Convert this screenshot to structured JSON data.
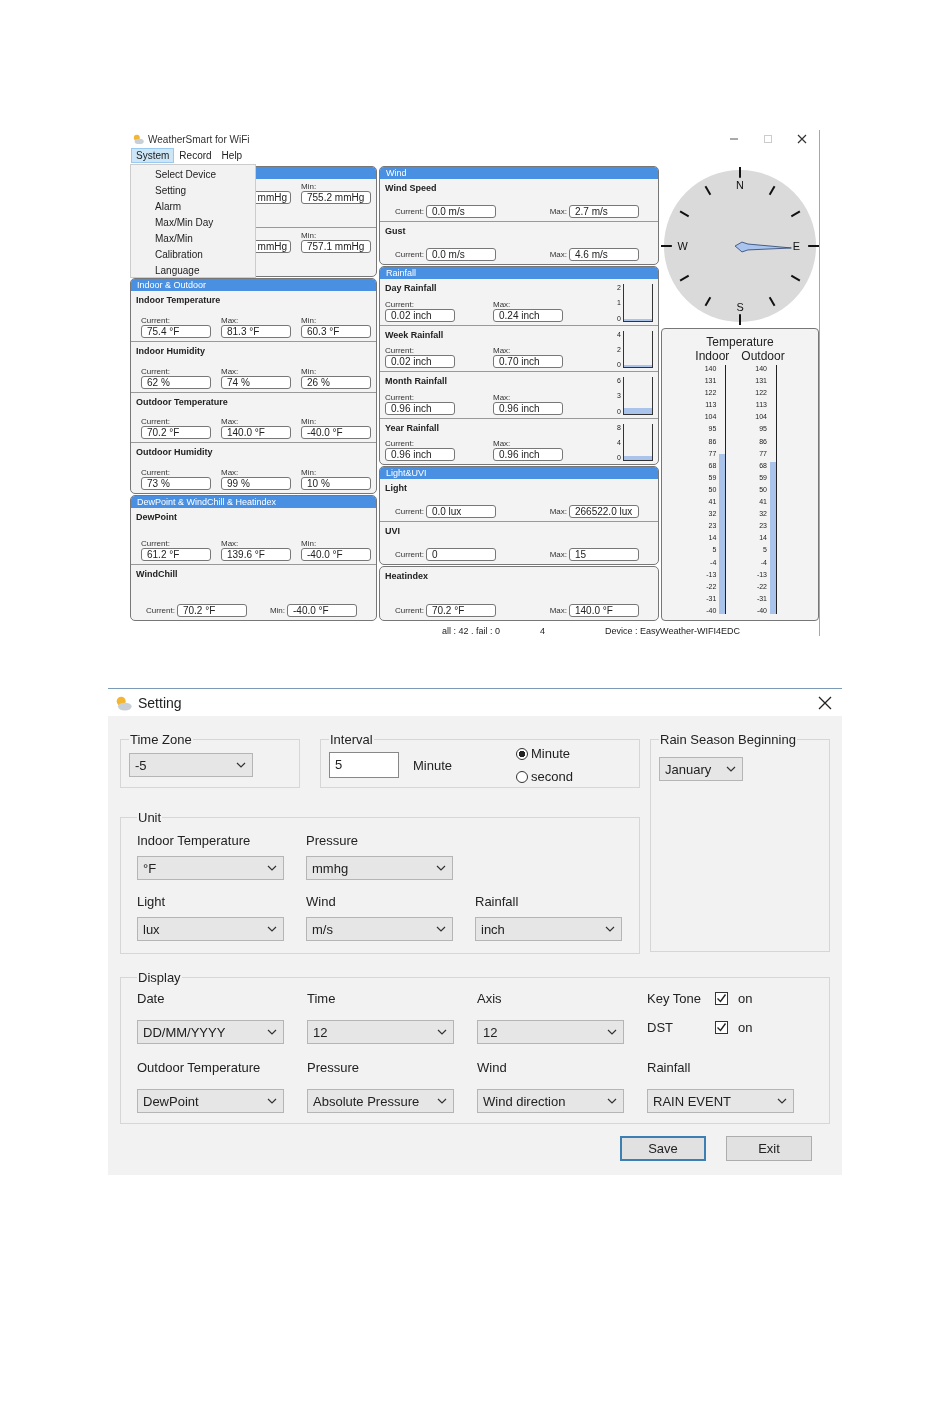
{
  "main_window": {
    "title": "WeatherSmart for WiFi",
    "menu": [
      {
        "label": "System",
        "selected": true
      },
      {
        "label": "Record",
        "selected": false
      },
      {
        "label": "Help",
        "selected": false
      }
    ],
    "open_menu": {
      "items": [
        "Select Device",
        "Setting",
        "Alarm",
        "Max/Min Day",
        "Max/Min",
        "Calibration",
        "Language"
      ]
    },
    "columns": [
      {
        "panels": [
          {
            "kind": "headed",
            "sections": [
              {
                "kind": "stacked",
                "fields": [
                  {
                    "value": "mmHg"
                  },
                  {
                    "label": "Min:",
                    "value": "755.2 mmHg"
                  }
                ]
              },
              {
                "kind": "stacked",
                "fields": [
                  {
                    "value": "mmHg"
                  },
                  {
                    "label": "Min:",
                    "value": "757.1 mmHg"
                  }
                ]
              }
            ]
          },
          {
            "kind": "headed",
            "header": "Indoor & Outdoor",
            "sections": [
              {
                "kind": "stacked",
                "title": "Indoor Temperature",
                "fields": [
                  {
                    "label": "Current:",
                    "value": "75.4 °F"
                  },
                  {
                    "label": "Max:",
                    "value": "81.3 °F"
                  },
                  {
                    "label": "Min:",
                    "value": "60.3 °F"
                  }
                ]
              },
              {
                "kind": "stacked",
                "title": "Indoor Humidity",
                "fields": [
                  {
                    "label": "Current:",
                    "value": "62 %"
                  },
                  {
                    "label": "Max:",
                    "value": "74 %"
                  },
                  {
                    "label": "Min:",
                    "value": "26 %"
                  }
                ]
              },
              {
                "kind": "stacked",
                "title": "Outdoor Temperature",
                "fields": [
                  {
                    "label": "Current:",
                    "value": "70.2 °F"
                  },
                  {
                    "label": "Max:",
                    "value": "140.0 °F"
                  },
                  {
                    "label": "Min:",
                    "value": "-40.0 °F"
                  }
                ]
              },
              {
                "kind": "stacked",
                "title": "Outdoor Humidity",
                "fields": [
                  {
                    "label": "Current:",
                    "value": "73 %"
                  },
                  {
                    "label": "Max:",
                    "value": "99 %"
                  },
                  {
                    "label": "Min:",
                    "value": "10 %"
                  }
                ]
              }
            ]
          },
          {
            "kind": "headed",
            "header": "DewPoint & WindChill & Heatindex",
            "sections": [
              {
                "kind": "stacked",
                "title": "DewPoint",
                "fields": [
                  {
                    "label": "Current:",
                    "value": "61.2 °F"
                  },
                  {
                    "label": "Max:",
                    "value": "139.6 °F"
                  },
                  {
                    "label": "Min:",
                    "value": "-40.0 °F"
                  }
                ]
              },
              {
                "kind": "inline",
                "title": "WindChill",
                "fields": [
                  {
                    "label": "Current:",
                    "value": "70.2 °F"
                  },
                  {
                    "label": "Min:",
                    "value": "-40.0 °F"
                  }
                ]
              }
            ]
          }
        ]
      },
      {
        "panels": [
          {
            "kind": "headed",
            "header": "Wind",
            "sections": [
              {
                "kind": "inline",
                "title": "Wind Speed",
                "fields": [
                  {
                    "label": "Current:",
                    "value": "0.0 m/s"
                  },
                  {
                    "label": "Max:",
                    "value": "2.7 m/s"
                  }
                ]
              },
              {
                "kind": "inline",
                "title": "Gust",
                "fields": [
                  {
                    "label": "Current:",
                    "value": "0.0 m/s"
                  },
                  {
                    "label": "Max:",
                    "value": "4.6 m/s"
                  }
                ]
              }
            ]
          },
          {
            "kind": "headed",
            "header": "Rainfall",
            "sections": [
              {
                "kind": "stacked",
                "title": "Day Rainfall",
                "fields": [
                  {
                    "label": "Current:",
                    "value": "0.02 inch"
                  },
                  {
                    "label": "Max:",
                    "value": "0.24 inch"
                  }
                ],
                "gauge": {
                  "ticks": [
                    "2",
                    "1",
                    "0"
                  ],
                  "level": 0.01
                }
              },
              {
                "kind": "stacked",
                "title": "Week Rainfall",
                "fields": [
                  {
                    "label": "Current:",
                    "value": "0.02 inch"
                  },
                  {
                    "label": "Max:",
                    "value": "0.70 inch"
                  }
                ],
                "gauge": {
                  "ticks": [
                    "4",
                    "2",
                    "0"
                  ],
                  "level": 0.005
                }
              },
              {
                "kind": "stacked",
                "title": "Month Rainfall",
                "fields": [
                  {
                    "label": "Current:",
                    "value": "0.96 inch"
                  },
                  {
                    "label": "Max:",
                    "value": "0.96 inch"
                  }
                ],
                "gauge": {
                  "ticks": [
                    "6",
                    "3",
                    "0"
                  ],
                  "level": 0.16
                }
              },
              {
                "kind": "stacked",
                "title": "Year Rainfall",
                "fields": [
                  {
                    "label": "Current:",
                    "value": "0.96 inch"
                  },
                  {
                    "label": "Max:",
                    "value": "0.96 inch"
                  }
                ],
                "gauge": {
                  "ticks": [
                    "8",
                    "4",
                    "0"
                  ],
                  "level": 0.12
                }
              }
            ]
          },
          {
            "kind": "headed",
            "header": "Light&UVI",
            "sections": [
              {
                "kind": "inline",
                "title": "Light",
                "fields": [
                  {
                    "label": "Current:",
                    "value": "0.0 lux"
                  },
                  {
                    "label": "Max:",
                    "value": "266522.0 lux"
                  }
                ]
              },
              {
                "kind": "inline",
                "title": "UVI",
                "fields": [
                  {
                    "label": "Current:",
                    "value": "0"
                  },
                  {
                    "label": "Max:",
                    "value": "15"
                  }
                ]
              }
            ]
          },
          {
            "kind": "plain",
            "sections": [
              {
                "kind": "inline",
                "title": "Heatindex",
                "fields": [
                  {
                    "label": "Current:",
                    "value": "70.2 °F"
                  },
                  {
                    "label": "Max:",
                    "value": "140.0 °F"
                  }
                ]
              }
            ]
          }
        ]
      }
    ],
    "compass": {
      "points": [
        "N",
        "E",
        "S",
        "W"
      ]
    },
    "temperature": {
      "title": "Temperature",
      "thermometers": [
        {
          "label": "Indoor",
          "level": 0.641,
          "ticks": [
            "140",
            "131",
            "122",
            "113",
            "104",
            "95",
            "86",
            "77",
            "68",
            "59",
            "50",
            "41",
            "32",
            "23",
            "14",
            "5",
            "-4",
            "-13",
            "-22",
            "-31",
            "-40"
          ]
        },
        {
          "label": "Outdoor",
          "level": 0.612,
          "ticks": [
            "140",
            "131",
            "122",
            "113",
            "104",
            "95",
            "86",
            "77",
            "68",
            "59",
            "50",
            "41",
            "32",
            "23",
            "14",
            "5",
            "-4",
            "-13",
            "-22",
            "-31",
            "-40"
          ]
        }
      ]
    },
    "status_bar": [
      "all : 42 . fail : 0",
      "4",
      "Device : EasyWeather-WIFI4EDC"
    ]
  },
  "setting_dialog": {
    "title": "Setting",
    "time_zone": {
      "legend": "Time Zone",
      "value": "-5"
    },
    "interval": {
      "legend": "Interval",
      "value": "5",
      "unit": "Minute",
      "options": [
        {
          "label": "Minute",
          "selected": true
        },
        {
          "label": "second",
          "selected": false
        }
      ]
    },
    "rain_season": {
      "legend": "Rain Season Beginning",
      "value": "January"
    },
    "unit": {
      "legend": "Unit",
      "rows": [
        [
          {
            "kind": "select",
            "label": "Indoor Temperature",
            "value": "°F"
          },
          {
            "kind": "select",
            "label": "Pressure",
            "value": "mmhg"
          }
        ],
        [
          {
            "kind": "select",
            "label": "Light",
            "value": "lux"
          },
          {
            "kind": "select",
            "label": "Wind",
            "value": "m/s"
          },
          {
            "kind": "select",
            "label": "Rainfall",
            "value": "inch"
          }
        ]
      ]
    },
    "display": {
      "legend": "Display",
      "rows": [
        [
          {
            "kind": "select",
            "label": "Date",
            "value": "DD/MM/YYYY"
          },
          {
            "kind": "select",
            "label": "Time",
            "value": "12"
          },
          {
            "kind": "select",
            "label": "Axis",
            "value": "12"
          },
          {
            "kind": "toggles",
            "items": [
              {
                "label": "Key Tone",
                "checked": true,
                "text": "on"
              },
              {
                "label": "DST",
                "checked": true,
                "text": "on"
              }
            ]
          }
        ],
        [
          {
            "kind": "select",
            "label": "Outdoor Temperature",
            "value": "DewPoint"
          },
          {
            "kind": "select",
            "label": "Pressure",
            "value": "Absolute Pressure"
          },
          {
            "kind": "select",
            "label": "Wind",
            "value": "Wind direction"
          },
          {
            "kind": "select",
            "label": "Rainfall",
            "value": "RAIN EVENT"
          }
        ]
      ]
    },
    "buttons": [
      {
        "label": "Save",
        "focused": true
      },
      {
        "label": "Exit",
        "focused": false
      }
    ]
  }
}
